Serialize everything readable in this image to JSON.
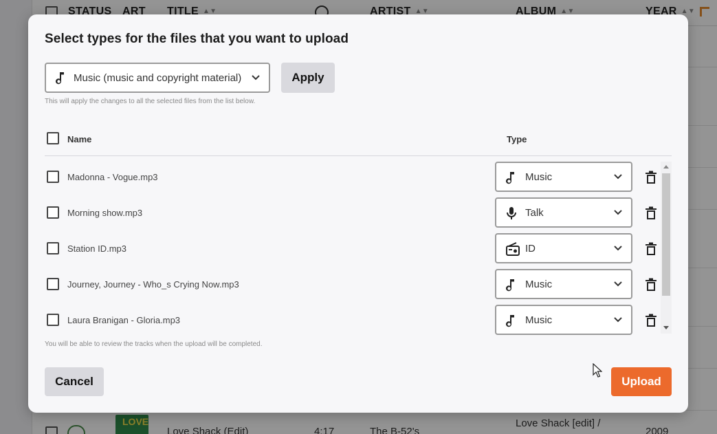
{
  "background": {
    "headers": {
      "status": "STATUS",
      "art": "ART",
      "title": "TITLE",
      "artist": "ARTIST",
      "album": "ALBUM",
      "year": "YEAR"
    },
    "row": {
      "title": "Love Shack (Edit)",
      "duration": "4:17",
      "artist": "The B-52's",
      "album": "Love Shack [edit] /",
      "year": "2009",
      "art_text": "LOVE"
    }
  },
  "modal": {
    "title": "Select types for the files that you want to upload",
    "bulk_select": {
      "value": "Music (music and copyright material)",
      "icon": "music-note-icon"
    },
    "apply_label": "Apply",
    "apply_hint": "This will apply the changes to all the selected files from the list below.",
    "columns": {
      "name": "Name",
      "type": "Type"
    },
    "files": [
      {
        "name": "Madonna - Vogue.mp3",
        "type": "Music",
        "icon": "music-note-icon"
      },
      {
        "name": "Morning show.mp3",
        "type": "Talk",
        "icon": "microphone-icon"
      },
      {
        "name": "Station ID.mp3",
        "type": "ID",
        "icon": "radio-icon"
      },
      {
        "name": "Journey, Journey - Who_s Crying Now.mp3",
        "type": "Music",
        "icon": "music-note-icon"
      },
      {
        "name": "Laura Branigan - Gloria.mp3",
        "type": "Music",
        "icon": "music-note-icon"
      }
    ],
    "bottom_hint": "You will be able to review the tracks when the upload will be completed.",
    "cancel_label": "Cancel",
    "upload_label": "Upload"
  },
  "colors": {
    "accent": "#ec6a2c",
    "secondary_button": "#d9d9de"
  }
}
